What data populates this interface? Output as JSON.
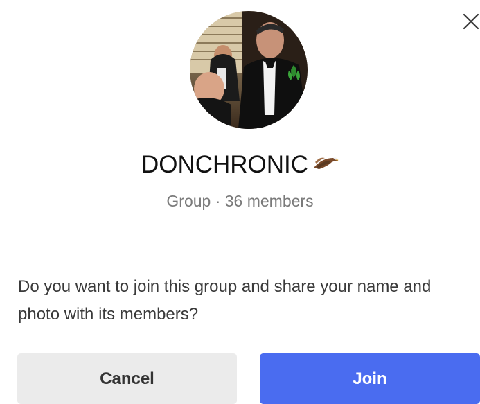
{
  "dialog": {
    "group_name": "DONCHRONIC",
    "subtitle": "Group · 36 members",
    "question": "Do you want to join this group and share your name and photo with its members?",
    "cancel_label": "Cancel",
    "join_label": "Join",
    "close_icon": "close-icon",
    "title_emoji_icon": "eagle-icon"
  },
  "colors": {
    "accent": "#4a6cf0",
    "cancel_bg": "#ebebeb",
    "subtitle_text": "#7a7a7a"
  }
}
